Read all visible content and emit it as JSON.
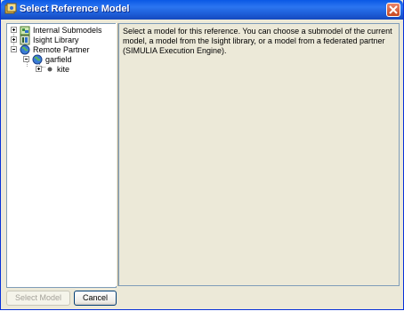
{
  "window": {
    "title": "Select Reference Model"
  },
  "tree": {
    "items": [
      {
        "label": "Internal Submodels",
        "icon": "submodel-folder-icon"
      },
      {
        "label": "Isight Library",
        "icon": "library-icon"
      },
      {
        "label": "Remote Partner",
        "icon": "globe-icon"
      },
      {
        "label": "garfield",
        "icon": "globe-icon"
      },
      {
        "label": "kite",
        "icon": "dot-icon"
      }
    ]
  },
  "info": {
    "text": "Select a model for this reference.  You can choose a submodel of the current model, a model from the Isight library, or a model from a federated partner (SIMULIA Execution Engine)."
  },
  "buttons": {
    "select_label": "Select Model",
    "cancel_label": "Cancel"
  }
}
